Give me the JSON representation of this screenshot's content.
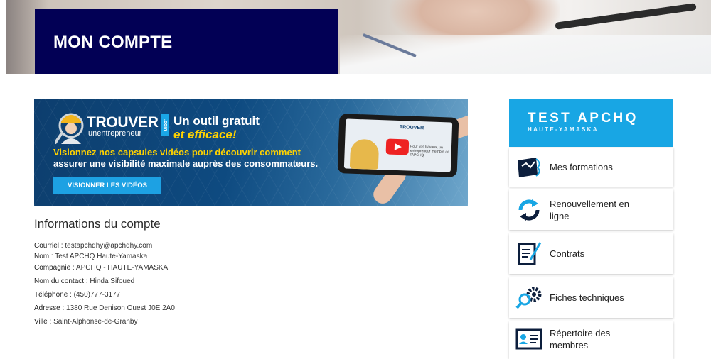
{
  "hero": {
    "title": "MON COMPTE"
  },
  "banner": {
    "logo_word": "TROUVER",
    "logo_sub": "unentrepreneur",
    "logo_com": ".com",
    "tagline_1": "Un outil gratuit",
    "tagline_2": "et efficace!",
    "promo_line_1": "Visionnez nos capsules vidéos pour découvrir comment",
    "promo_line_2": "assurer une visibilité maximale auprès des consommateurs.",
    "button_label": "VISIONNER LES VIDÉOS",
    "screen_logo": "TROUVER",
    "screen_text": "Pour vos travaux, un entrepreneur membre de l'APCHQ"
  },
  "account": {
    "title": "Informations du compte",
    "fields": [
      {
        "label": "Courriel",
        "value": "testapchqhy@apchqhy.com"
      },
      {
        "label": "Nom",
        "value": "Test APCHQ Haute-Yamaska"
      },
      {
        "label": "Compagnie",
        "value": "APCHQ - HAUTE-YAMASKA"
      },
      {
        "label": "Nom du contact",
        "value": "Hinda Sifoued"
      },
      {
        "label": "Téléphone",
        "value": "(450)777-3177"
      },
      {
        "label": "Adresse",
        "value": "1380 Rue Denison Ouest J0E 2A0"
      },
      {
        "label": "Ville",
        "value": "Saint-Alphonse-de-Granby"
      }
    ]
  },
  "sidebar": {
    "name": "TEST APCHQ",
    "subtitle": "HAUTE-YAMASKA",
    "items": [
      {
        "label": "Mes formations",
        "icon": "certificate-icon"
      },
      {
        "label": "Renouvellement en ligne",
        "icon": "renew-arrows-icon"
      },
      {
        "label": "Contrats",
        "icon": "contract-pen-icon"
      },
      {
        "label": "Fiches techniques",
        "icon": "gear-magnifier-icon"
      },
      {
        "label": "Répertoire des membres",
        "icon": "member-directory-icon"
      }
    ]
  },
  "colors": {
    "navy": "#020055",
    "accent": "#18a6e4",
    "yellow": "#ffd200"
  }
}
